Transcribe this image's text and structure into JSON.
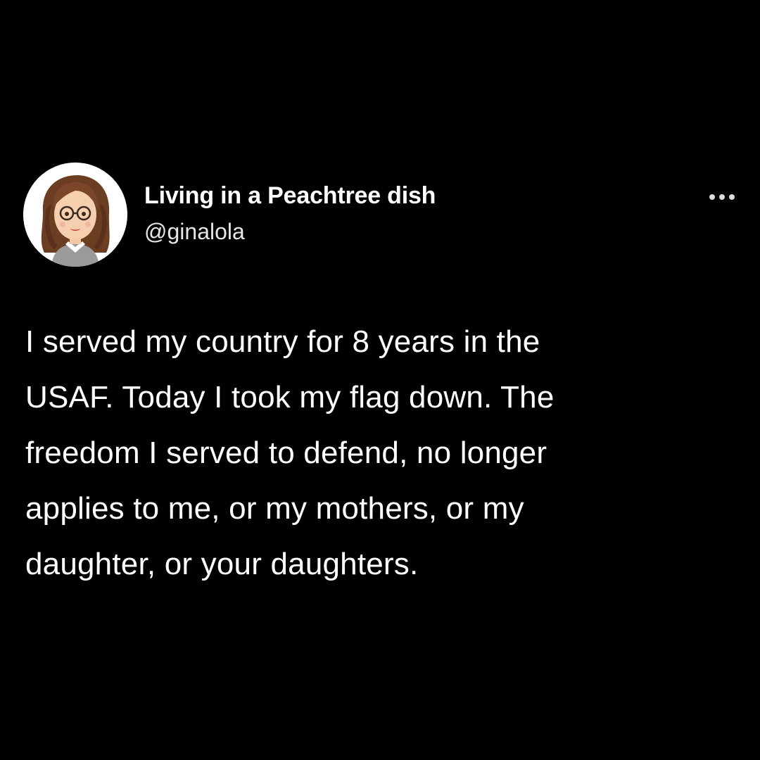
{
  "author": {
    "display_name": "Living in a Peachtree dish",
    "handle": "@ginalola",
    "avatar_icon": "cartoon-woman-avatar"
  },
  "menu": {
    "more_icon": "more-horizontal-icon"
  },
  "tweet": {
    "lines": [
      "I served my country for 8 years in the",
      "USAF. Today I took my flag down. The",
      "freedom I served to defend, no longer",
      "applies to me, or my mothers, or my",
      "daughter, or your daughters."
    ]
  },
  "colors": {
    "background": "#000000",
    "text": "#ffffff",
    "secondary_text": "#e4e6e8"
  }
}
